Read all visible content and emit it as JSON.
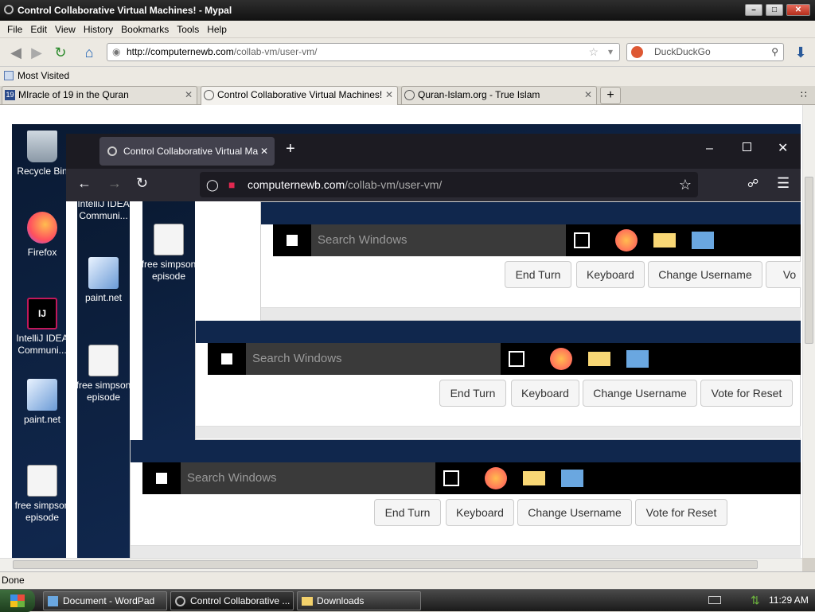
{
  "window": {
    "title": "Control Collaborative Virtual Machines! - Mypal"
  },
  "menu": [
    "File",
    "Edit",
    "View",
    "History",
    "Bookmarks",
    "Tools",
    "Help"
  ],
  "nav": {
    "url_host": "http://computernewb.com",
    "url_path": "/collab-vm/user-vm/",
    "search_placeholder": "DuckDuckGo"
  },
  "bookmarks": {
    "most_visited": "Most Visited"
  },
  "tabs": [
    {
      "label": "MIracle of 19 in the Quran",
      "icon": "19-icon"
    },
    {
      "label": "Control Collaborative Virtual Machines!",
      "icon": "globe-icon",
      "active": true
    },
    {
      "label": "Quran-Islam.org - True Islam",
      "icon": "globe-icon"
    }
  ],
  "vm": {
    "desktop_icons": [
      {
        "label": "Recycle Bin",
        "icon": "recycle-bin-icon"
      },
      {
        "label": "Firefox",
        "icon": "firefox-icon"
      },
      {
        "label": "IntelliJ IDEA Communi...",
        "icon": "intellij-icon"
      },
      {
        "label": "paint.net",
        "icon": "paintnet-icon"
      },
      {
        "label": "free simpson episode",
        "icon": "media-file-icon"
      }
    ],
    "nested_icons_col1": [
      {
        "label": "IntelliJ IDEA Communi..."
      },
      {
        "label": "paint.net"
      },
      {
        "label": "free simpson episode"
      }
    ],
    "nested_icons_col2": [
      {
        "label": "free simpson episode"
      }
    ],
    "ff": {
      "tab_label": "Control Collaborative Virtual Ma",
      "url_host": "computernewb.com",
      "url_path": "/collab-vm/user-vm/"
    },
    "win_search": "Search Windows",
    "buttons": {
      "end_turn": "End Turn",
      "keyboard": "Keyboard",
      "change_username": "Change Username",
      "vote_reset": "Vote for Reset",
      "vote_short": "Vo"
    }
  },
  "status": {
    "text": "Done"
  },
  "taskbar": {
    "items": [
      {
        "label": "Document - WordPad",
        "icon": "wordpad-icon"
      },
      {
        "label": "Control Collaborative ...",
        "icon": "globe-icon",
        "active": true
      },
      {
        "label": "Downloads",
        "icon": "folder-icon"
      }
    ],
    "clock": "11:29 AM"
  },
  "colors": {
    "firefox_dark": "#1c1b22",
    "firefox_toolbar": "#2b2a33",
    "win_taskbar": "#000000",
    "win_search": "#3a3a3a"
  }
}
